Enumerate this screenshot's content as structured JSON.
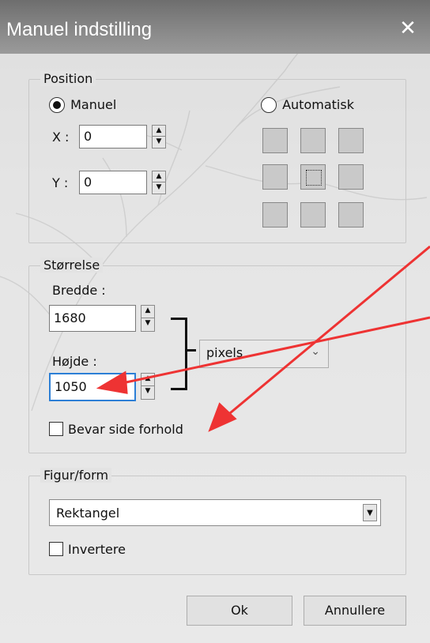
{
  "window": {
    "title": "Manuel indstilling",
    "close_glyph": "✕"
  },
  "position": {
    "group_label": "Position",
    "manual_label": "Manuel",
    "automatic_label": "Automatisk",
    "x_label": "X :",
    "x_value": "0",
    "y_label": "Y :",
    "y_value": "0"
  },
  "size": {
    "group_label": "Størrelse",
    "width_label": "Bredde :",
    "width_value": "1680",
    "height_label": "Højde :",
    "height_value": "1050",
    "unit_value": "pixels",
    "keep_ratio_label": "Bevar side forhold"
  },
  "shape": {
    "group_label": "Figur/form",
    "shape_value": "Rektangel",
    "invert_label": "Invertere"
  },
  "buttons": {
    "ok": "Ok",
    "cancel": "Annullere"
  },
  "colors": {
    "arrow": "#ee3333",
    "focus": "#2c7fd6"
  }
}
